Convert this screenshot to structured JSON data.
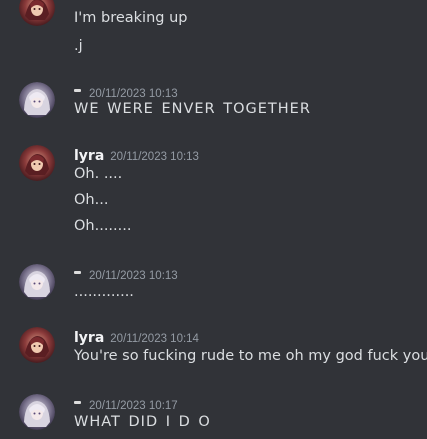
{
  "messages": [
    {
      "author": "",
      "avatar": "lyra-avatar",
      "lines": [
        "I'm breaking up",
        ".j"
      ]
    },
    {
      "author": "",
      "avatar": "white-haired-avatar",
      "timestamp": "20/11/2023 10:13",
      "lines": [
        "WE WERE ENVER TOGETHER"
      ]
    },
    {
      "author": "lyra",
      "avatar": "lyra-avatar",
      "timestamp": "20/11/2023 10:13",
      "lines": [
        "Oh. ....",
        "Oh...",
        "Oh........"
      ]
    },
    {
      "author": "",
      "avatar": "white-haired-avatar",
      "timestamp": "20/11/2023 10:13",
      "lines": [
        "............."
      ]
    },
    {
      "author": "lyra",
      "avatar": "lyra-avatar",
      "timestamp": "20/11/2023 10:14",
      "lines": [
        "You're so fucking rude to me oh my god fuck you"
      ]
    },
    {
      "author": "",
      "avatar": "white-haired-avatar",
      "timestamp": "20/11/2023 10:17",
      "lines": [
        "WHAT DID I D O"
      ]
    }
  ],
  "colors": {
    "background": "#313338",
    "text": "#dbdee1",
    "username": "#f2f3f5",
    "timestamp": "#949ba4"
  }
}
